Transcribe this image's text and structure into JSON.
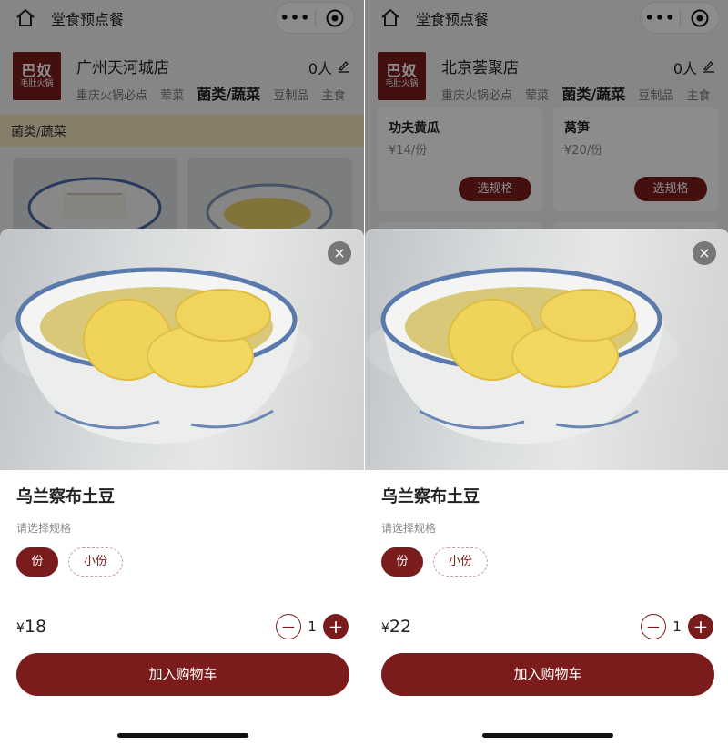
{
  "colors": {
    "brand": "#7a1c1c",
    "banner": "#f6e6c2",
    "mask": "rgba(0,0,0,0.45)"
  },
  "app_title": "堂食预点餐",
  "capsule": {
    "more": "•••"
  },
  "brand_logo": {
    "line1": "巴奴",
    "line2": "毛肚火锅"
  },
  "categories": [
    "重庆火锅必点",
    "荤菜",
    "菌类/蔬菜",
    "豆制品",
    "主食"
  ],
  "left": {
    "store_name": "广州天河城店",
    "people": "0人",
    "section_banner": "菌类/蔬菜",
    "sheet": {
      "dish_name": "乌兰察布土豆",
      "spec_label": "请选择规格",
      "options": [
        "份",
        "小份"
      ],
      "currency": "¥",
      "price": "18",
      "qty": "1",
      "add_cart": "加入购物车"
    }
  },
  "right": {
    "store_name": "北京荟聚店",
    "people": "0人",
    "cards": [
      {
        "name": "功夫黄瓜",
        "price": "¥14/份",
        "button": "选规格"
      },
      {
        "name": "莴笋",
        "price": "¥20/份",
        "button": "选规格"
      }
    ],
    "sheet": {
      "dish_name": "乌兰察布土豆",
      "spec_label": "请选择规格",
      "options": [
        "份",
        "小份"
      ],
      "currency": "¥",
      "price": "22",
      "qty": "1",
      "add_cart": "加入购物车"
    }
  }
}
